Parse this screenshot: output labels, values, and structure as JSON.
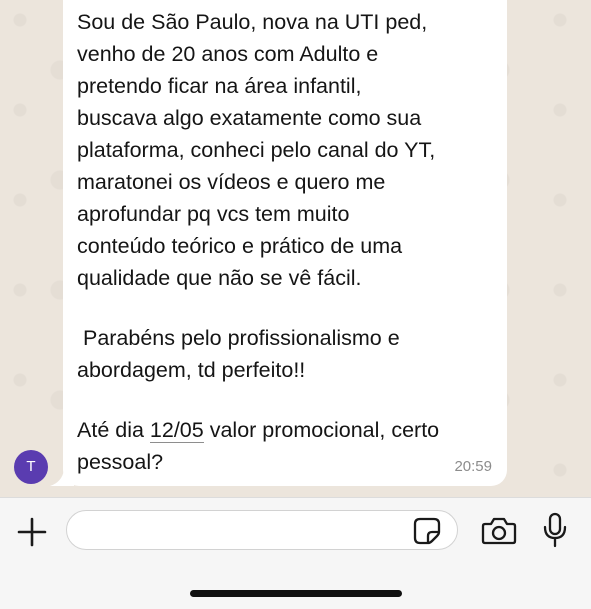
{
  "message": {
    "lines_paragraph1": [
      "Sou de São Paulo, nova na UTI ped,",
      "venho de 20 anos com Adulto e",
      "pretendo ficar na área infantil,",
      "buscava algo exatamente como sua",
      "plataforma, conheci pelo canal do YT,",
      "maratonei os vídeos e quero me",
      "aprofundar pq vcs tem muito",
      "conteúdo teórico e prático de uma",
      "qualidade que não se vê fácil."
    ],
    "lines_paragraph2": [
      " Parabéns pelo profissionalismo e",
      "abordagem, td perfeito!!"
    ],
    "p3_prefix": "Até dia ",
    "p3_date": "12/05",
    "p3_suffix": " valor promocional, certo",
    "p3_line2": "pessoal?",
    "time": "20:59"
  },
  "avatar": {
    "initial": "T",
    "color": "#5a3cb0"
  },
  "input_bar": {
    "placeholder": "",
    "icons": [
      "plus-icon",
      "sticker-icon",
      "camera-icon",
      "microphone-icon"
    ]
  }
}
